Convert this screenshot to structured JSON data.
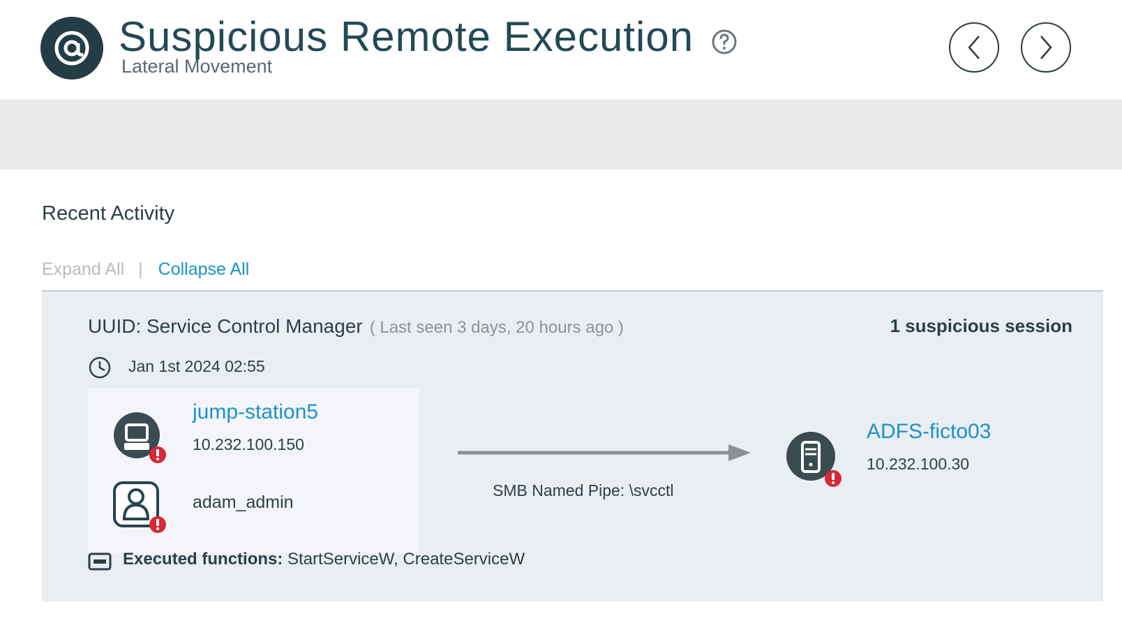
{
  "header": {
    "title": "Suspicious Remote Execution",
    "subtitle": "Lateral Movement",
    "icons": {
      "logo": "at-symbol-icon",
      "help": "question-circle-icon",
      "prev": "chevron-left-icon",
      "next": "chevron-right-icon"
    }
  },
  "activity": {
    "section_title": "Recent Activity",
    "expand_all": "Expand All",
    "separator": "|",
    "collapse_all": "Collapse All"
  },
  "session": {
    "uuid_label": "UUID: Service Control Manager",
    "last_seen": "( Last seen 3 days, 20 hours ago )",
    "suspicious_count": "1 suspicious session",
    "timestamp": "Jan 1st 2024 02:55",
    "source": {
      "host_name": "jump-station5",
      "host_ip": "10.232.100.150",
      "user": "adam_admin"
    },
    "protocol": "SMB Named Pipe: \\svcctl",
    "destination": {
      "host_name": "ADFS-ficto03",
      "host_ip": "10.232.100.30"
    },
    "functions_label": "Executed functions:",
    "functions_value": "StartServiceW, CreateServiceW"
  },
  "colors": {
    "accent_blue": "#1d91c7",
    "alert_red": "#d62836",
    "dark_icon": "#243c46"
  }
}
